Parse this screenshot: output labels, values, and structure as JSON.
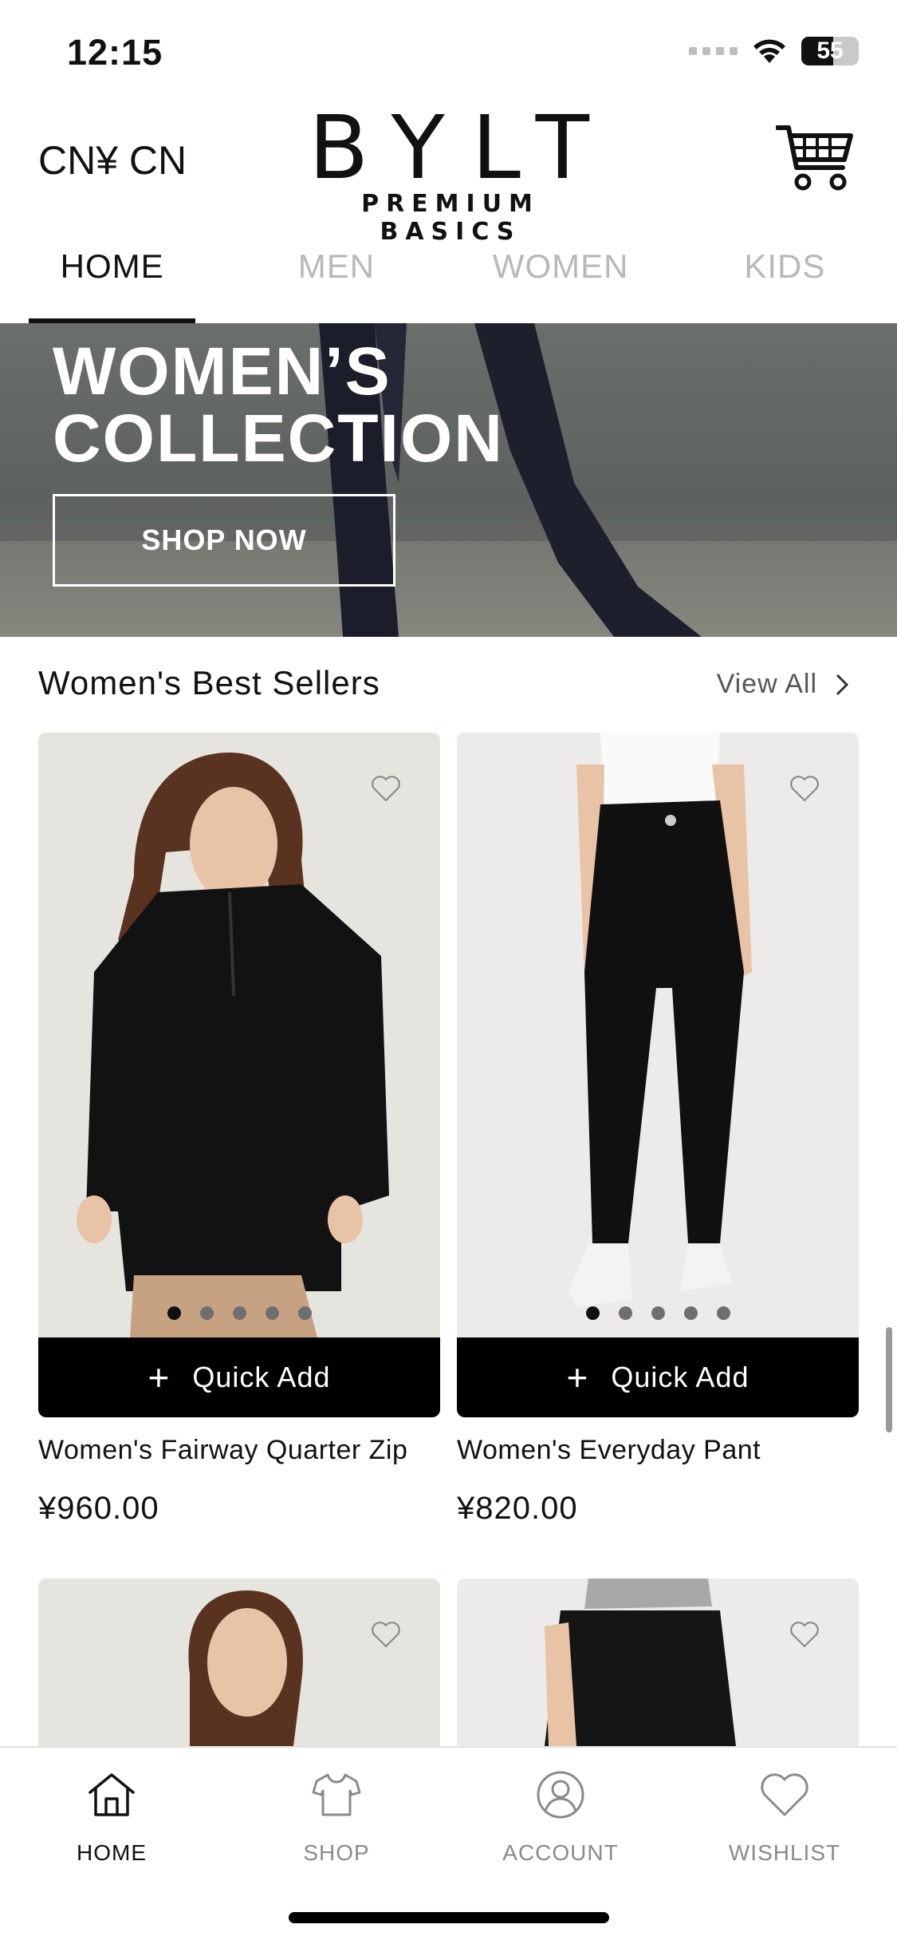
{
  "status_bar": {
    "time": "12:15",
    "battery": "55",
    "battery_level": 0.55
  },
  "header": {
    "currency": "CN¥ CN",
    "logo_main": "BYLT",
    "logo_sub": "PREMIUM BASICS",
    "cart_icon": "shopping-cart-icon"
  },
  "tabs": [
    {
      "label": "HOME",
      "active": true
    },
    {
      "label": "MEN",
      "active": false
    },
    {
      "label": "WOMEN",
      "active": false
    },
    {
      "label": "KIDS",
      "active": false
    }
  ],
  "banner": {
    "title_line1": "WOMEN’S",
    "title_line2": "COLLECTION",
    "button": "SHOP NOW"
  },
  "section": {
    "title": "Women's Best Sellers",
    "view_all": "View All"
  },
  "products": [
    {
      "name": "Women's Fairway Quarter Zip",
      "price": "¥960.00",
      "quick_add": "Quick Add",
      "image_dots": 5,
      "active_dot": 1
    },
    {
      "name": "Women's Everyday Pant",
      "price": "¥820.00",
      "quick_add": "Quick Add",
      "image_dots": 5,
      "active_dot": 1
    }
  ],
  "bottom_nav": [
    {
      "label": "HOME",
      "icon": "home-icon",
      "active": true
    },
    {
      "label": "SHOP",
      "icon": "tshirt-icon",
      "active": false
    },
    {
      "label": "ACCOUNT",
      "icon": "account-icon",
      "active": false
    },
    {
      "label": "WISHLIST",
      "icon": "heart-icon",
      "active": false
    }
  ],
  "colors": {
    "accent": "#000000",
    "inactive_tab": "#b8b8b8",
    "banner_bg": "#5d615f"
  }
}
